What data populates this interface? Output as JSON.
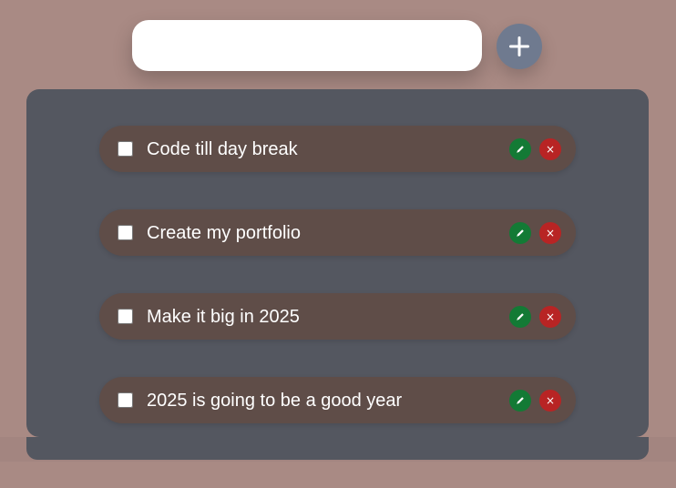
{
  "add_task": {
    "input_value": "",
    "input_placeholder": "",
    "add_icon": "plus-icon"
  },
  "tasks": [
    {
      "text": "Code till day break",
      "checked": false
    },
    {
      "text": "Create my portfolio",
      "checked": false
    },
    {
      "text": "Make it big in 2025",
      "checked": false
    },
    {
      "text": "2025 is going to be a good year",
      "checked": false
    }
  ],
  "actions": {
    "edit_icon": "pencil-icon",
    "delete_icon": "x-icon",
    "delete_glyph": "×"
  },
  "colors": {
    "background": "#a98a84",
    "panel": "#545760",
    "task_item": "#5f4d48",
    "add_button": "#6f7a8f",
    "edit_button": "#137a35",
    "delete_button": "#b82424"
  }
}
